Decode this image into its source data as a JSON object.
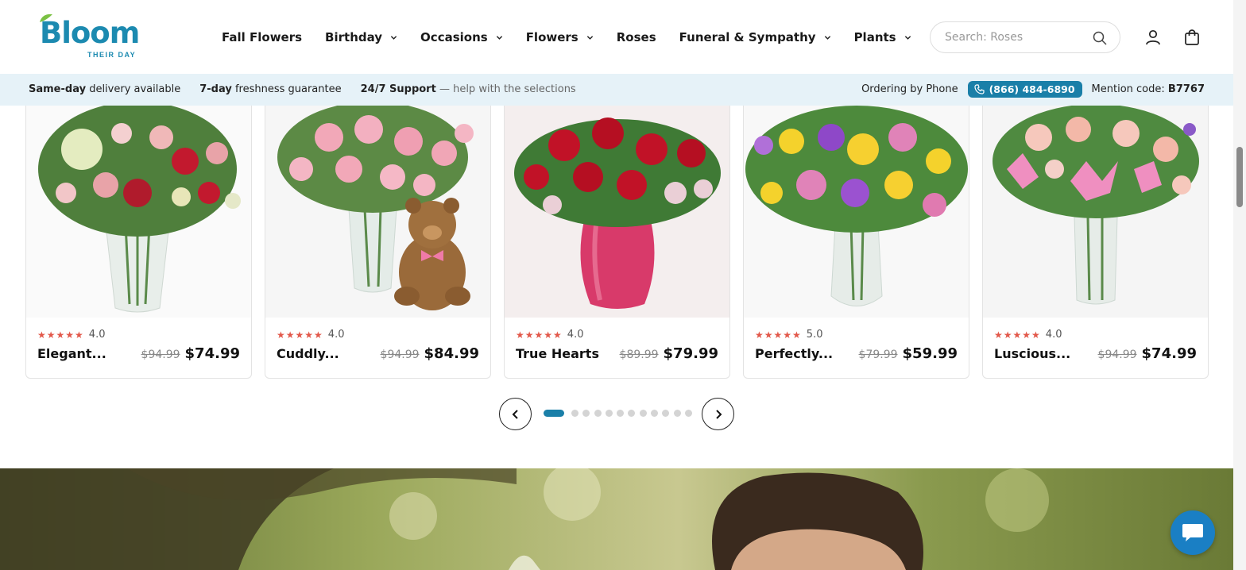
{
  "brand": {
    "name": "Bloom",
    "tagline": "THEIR DAY",
    "accent_color": "#1c8ab0"
  },
  "nav": {
    "items": [
      {
        "label": "Fall Flowers",
        "has_dropdown": false
      },
      {
        "label": "Birthday",
        "has_dropdown": true
      },
      {
        "label": "Occasions",
        "has_dropdown": true
      },
      {
        "label": "Flowers",
        "has_dropdown": true
      },
      {
        "label": "Roses",
        "has_dropdown": false
      },
      {
        "label": "Funeral & Sympathy",
        "has_dropdown": true
      },
      {
        "label": "Plants",
        "has_dropdown": true
      }
    ]
  },
  "search": {
    "placeholder": "Search: Roses",
    "icon": "search-icon"
  },
  "header_icons": [
    "account-icon",
    "cart-icon"
  ],
  "infobar": {
    "same_day_bold": "Same-day",
    "same_day_rest": "delivery available",
    "freshness_bold": "7-day",
    "freshness_rest": "freshness guarantee",
    "support_bold": "24/7 Support",
    "support_rest": "— help with the selections",
    "ordering_label": "Ordering by Phone",
    "phone": "(866) 484-6890",
    "mention_label": "Mention code:",
    "mention_code": "B7767"
  },
  "products": [
    {
      "name": "Elegant...",
      "rating": "4.0",
      "stars": "★★★★★",
      "old_price": "$94.99",
      "price": "$74.99"
    },
    {
      "name": "Cuddly...",
      "rating": "4.0",
      "stars": "★★★★★",
      "old_price": "$94.99",
      "price": "$84.99"
    },
    {
      "name": "True Hearts",
      "rating": "4.0",
      "stars": "★★★★★",
      "old_price": "$89.99",
      "price": "$79.99"
    },
    {
      "name": "Perfectly...",
      "rating": "5.0",
      "stars": "★★★★★",
      "old_price": "$79.99",
      "price": "$59.99"
    },
    {
      "name": "Luscious...",
      "rating": "4.0",
      "stars": "★★★★★",
      "old_price": "$94.99",
      "price": "$74.99"
    }
  ],
  "carousel": {
    "total_pages": 12,
    "active_page": 1
  },
  "colors": {
    "infobar_bg": "#e6f2f8",
    "phone_pill": "#1a7fa8",
    "star": "#e2584a",
    "chat_button": "#1a7fc4"
  }
}
